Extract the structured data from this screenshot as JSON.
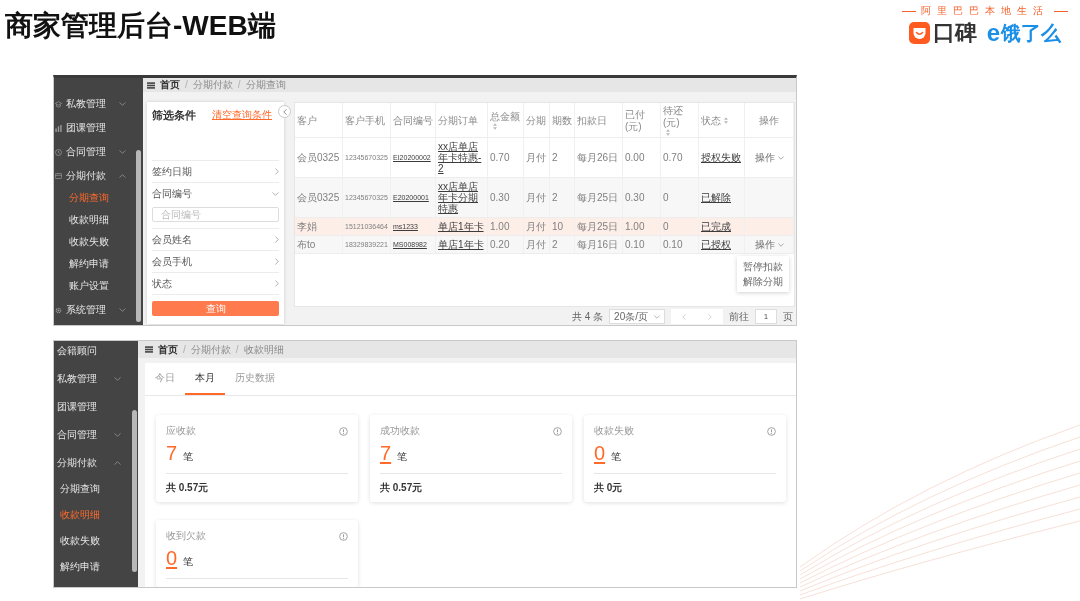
{
  "slide": {
    "title": "商家管理后台-WEB端"
  },
  "brand": {
    "tagline": "阿里巴巴本地生活",
    "koubei": "口碑",
    "eleme_mark": "e",
    "eleme": "饿了么"
  },
  "screenshots": [
    {
      "kind": "query",
      "sidebar": [
        {
          "label": "私教管理",
          "kind": "group",
          "expanded": false,
          "selected": false
        },
        {
          "label": "团课管理",
          "kind": "link",
          "selected": false
        },
        {
          "label": "合同管理",
          "kind": "group",
          "expanded": false,
          "selected": false
        },
        {
          "label": "分期付款",
          "kind": "group",
          "expanded": true,
          "selected": false,
          "children": [
            {
              "label": "分期查询",
              "selected": true
            },
            {
              "label": "收款明细",
              "selected": false
            },
            {
              "label": "收款失败",
              "selected": false
            },
            {
              "label": "解约申请",
              "selected": false
            },
            {
              "label": "账户设置",
              "selected": false
            }
          ]
        },
        {
          "label": "系统管理",
          "kind": "group",
          "expanded": false,
          "selected": false
        }
      ],
      "breadcrumb": [
        {
          "label": "首页"
        },
        {
          "separator": "/",
          "label": "分期付款"
        },
        {
          "separator": "/",
          "label": "分期查询"
        }
      ],
      "filter_panel": {
        "title": "筛选条件",
        "clear_link": "清空查询条件",
        "fields": [
          {
            "label": "签约日期",
            "expanded": false
          },
          {
            "label": "合同编号",
            "expanded": true,
            "placeholder": "合同编号"
          },
          {
            "label": "会员姓名",
            "expanded": false
          },
          {
            "label": "会员手机",
            "expanded": false
          },
          {
            "label": "状态",
            "expanded": false
          }
        ],
        "submit": "查询"
      },
      "table": {
        "columns": [
          {
            "label": "客户",
            "sortable": false,
            "link": false
          },
          {
            "label": "客户手机",
            "sortable": false,
            "link": false
          },
          {
            "label": "合同编号",
            "sortable": false,
            "link": true
          },
          {
            "label": "分期订单",
            "sortable": false,
            "link": true
          },
          {
            "label": "总金额",
            "sortable": true,
            "link": false
          },
          {
            "label": "分期",
            "sortable": false,
            "link": false
          },
          {
            "label": "期数",
            "sortable": false,
            "link": false
          },
          {
            "label": "扣款日",
            "sortable": false,
            "link": false
          },
          {
            "label": "已付(元)",
            "sortable": false,
            "link": false
          },
          {
            "label": "待还(元)",
            "sortable": true,
            "link": false
          },
          {
            "label": "状态",
            "sortable": true,
            "link": true
          },
          {
            "label": "操作",
            "sortable": false,
            "link": false
          }
        ],
        "rows": [
          {
            "cells": [
              "会员0325",
              "12345670325",
              "EI20200002",
              "xx店单店年卡特惠-2",
              "0.70",
              "月付",
              "2",
              "每月26日",
              "0.00",
              "0.70",
              "授权失败"
            ],
            "action": "操作",
            "selected": false
          },
          {
            "cells": [
              "会员0325",
              "12345670325",
              "E20200001",
              "xx店单店年卡分期特惠",
              "0.30",
              "月付",
              "2",
              "每月25日",
              "0.30",
              "0",
              "已解除"
            ],
            "selected": false
          },
          {
            "cells": [
              "李娟",
              "15121036464",
              "ms1233",
              "单店1年卡",
              "1.00",
              "月付",
              "10",
              "每月25日",
              "1.00",
              "0",
              "已完成"
            ],
            "selected": true
          },
          {
            "cells": [
              "布to",
              "18329839221",
              "MS008982",
              "单店1年卡",
              "0.20",
              "月付",
              "2",
              "每月16日",
              "0.10",
              "0.10",
              "已授权"
            ],
            "action": "操作",
            "menu": [
              "暂停扣款",
              "解除分期"
            ],
            "selected": false
          }
        ]
      },
      "pagination": {
        "total": "共 4 条",
        "page_size": "20条/页",
        "prev_disabled": true,
        "next_disabled": true,
        "goto": "前往",
        "page": "1",
        "unit": "页"
      }
    },
    {
      "kind": "receipts",
      "sidebar": [
        {
          "label": "会籍顾问",
          "kind": "link",
          "selected": false
        },
        {
          "label": "私教管理",
          "kind": "group",
          "expanded": false,
          "selected": false
        },
        {
          "label": "团课管理",
          "kind": "link",
          "selected": false
        },
        {
          "label": "合同管理",
          "kind": "group",
          "expanded": false,
          "selected": false
        },
        {
          "label": "分期付款",
          "kind": "group",
          "expanded": true,
          "selected": false,
          "children": [
            {
              "label": "分期查询",
              "selected": false
            },
            {
              "label": "收款明细",
              "selected": true
            },
            {
              "label": "收款失败",
              "selected": false
            },
            {
              "label": "解约申请",
              "selected": false
            }
          ]
        }
      ],
      "breadcrumb": [
        {
          "label": "首页"
        },
        {
          "separator": "/",
          "label": "分期付款"
        },
        {
          "separator": "/",
          "label": "收款明细"
        }
      ],
      "tabs": [
        {
          "label": "今日",
          "selected": false
        },
        {
          "label": "本月",
          "selected": true
        },
        {
          "label": "历史数据",
          "selected": false
        }
      ],
      "cards": [
        {
          "title": "应收款",
          "count": "7",
          "unit": "笔",
          "linked": false,
          "total": "共 0.57元"
        },
        {
          "title": "成功收款",
          "count": "7",
          "unit": "笔",
          "linked": true,
          "total": "共 0.57元"
        },
        {
          "title": "收款失败",
          "count": "0",
          "unit": "笔",
          "linked": true,
          "total": "共 0元"
        },
        {
          "title": "收到欠款",
          "count": "0",
          "unit": "笔",
          "linked": true
        }
      ]
    }
  ]
}
